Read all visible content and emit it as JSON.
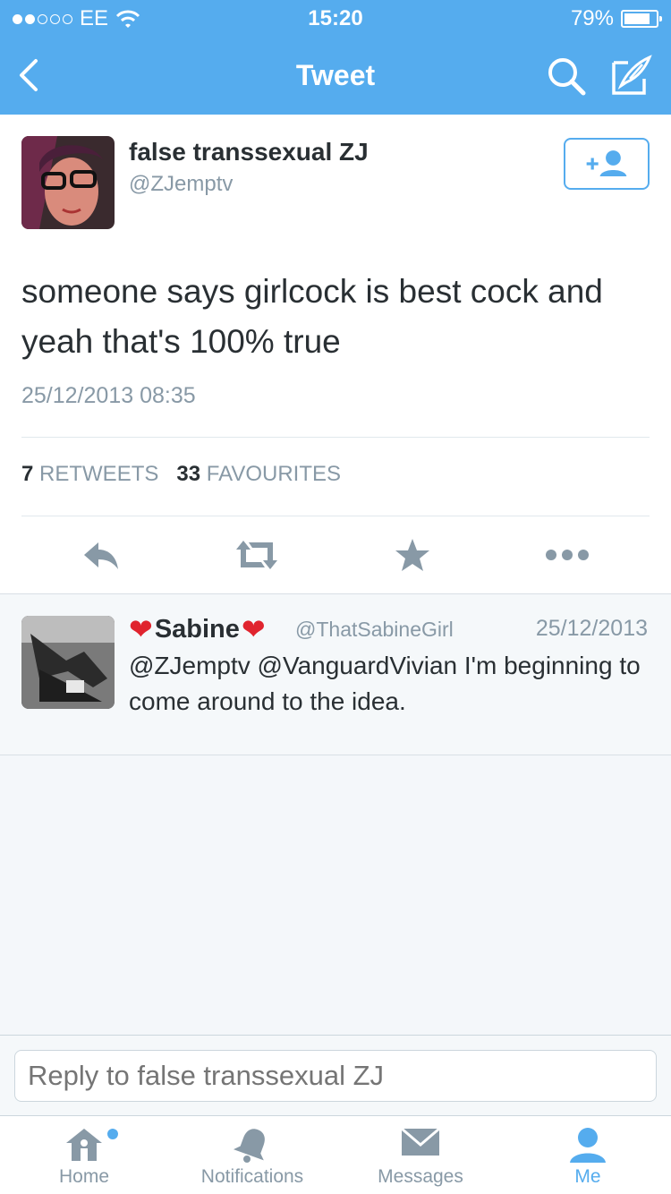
{
  "status_bar": {
    "carrier": "EE",
    "time": "15:20",
    "battery": "79%"
  },
  "nav": {
    "title": "Tweet"
  },
  "tweet": {
    "author_name": "false transsexual ZJ",
    "author_handle": "@ZJemptv",
    "text": "someone says girlcock is best cock and yeah that's 100% true",
    "date": "25/12/2013 08:35",
    "retweets_count": "7",
    "retweets_label": "RETWEETS",
    "favourites_count": "33",
    "favourites_label": "FAVOURITES"
  },
  "reply": {
    "author_name": "Sabine",
    "heart": "❤",
    "author_handle": "@ThatSabineGirl",
    "date": "25/12/2013",
    "text": "@ZJemptv @VanguardVivian I'm beginning to come around to the idea."
  },
  "compose": {
    "placeholder": "Reply to false transsexual ZJ"
  },
  "tabs": [
    {
      "label": "Home",
      "icon": "home-icon"
    },
    {
      "label": "Notifications",
      "icon": "bell-icon"
    },
    {
      "label": "Messages",
      "icon": "envelope-icon"
    },
    {
      "label": "Me",
      "icon": "person-icon"
    }
  ],
  "colors": {
    "brand": "#55acee",
    "muted": "#8899a6",
    "text": "#292f33"
  }
}
